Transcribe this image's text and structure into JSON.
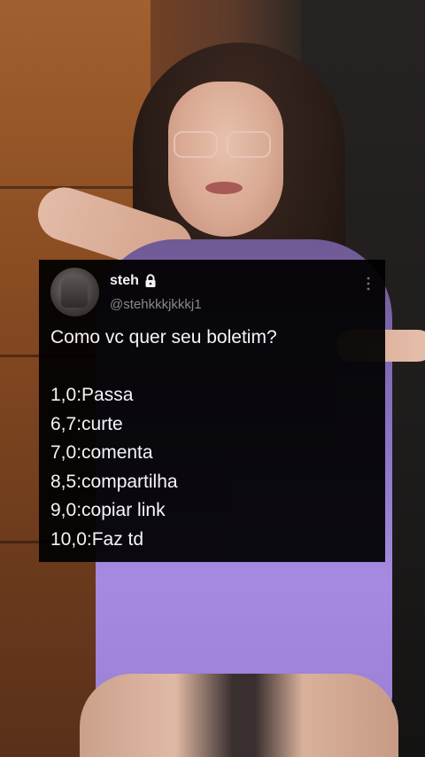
{
  "tweet": {
    "display_name": "steh",
    "handle": "@stehkkkjkkkj1",
    "icons": {
      "lock": "lock-icon",
      "more": "more-vertical-icon"
    },
    "question": "Como vc quer seu boletim?",
    "options": [
      "1,0:Passa",
      "6,7:curte",
      "7,0:comenta",
      "8,5:compartilha",
      "9,0:copiar link",
      "10,0:Faz td"
    ]
  },
  "colors": {
    "card_background": "#000000",
    "text_primary": "#ffffff",
    "text_secondary": "#8b8b8b",
    "sweater": "#a58ae0"
  }
}
